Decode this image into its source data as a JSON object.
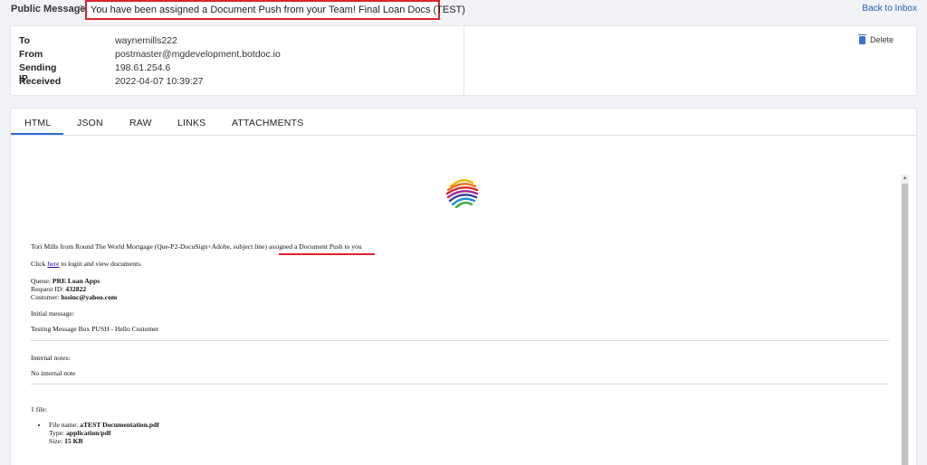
{
  "breadcrumb": {
    "root": "Public Message",
    "separator": ">",
    "subject": "You have been assigned a Document Push from your Team! Final Loan Docs (TEST)"
  },
  "back_link": "Back to Inbox",
  "details": {
    "to_label": "To",
    "to_value": "waynemills222",
    "from_label": "From",
    "from_value": "postmaster@mgdevelopment.botdoc.io",
    "ip_label": "Sending IP",
    "ip_value": "198.61.254.6",
    "received_label": "Received",
    "received_value": "2022-04-07 10:39:27"
  },
  "delete_label": "Delete",
  "tabs": [
    "HTML",
    "JSON",
    "RAW",
    "LINKS",
    "ATTACHMENTS"
  ],
  "active_tab": "HTML",
  "email": {
    "intro": "Tori Mills from Round The World Mortgage (Que-P2-DocuSign+Adobe, subject line) ",
    "intro_highlight": "assigned a Document Push to you",
    "click_prefix": "Click ",
    "click_link": "here",
    "click_suffix": " to login and view documents.",
    "queue_label": "Queue: ",
    "queue_value": "PRE Loan Apps",
    "request_label": "Request ID: ",
    "request_value": "432822",
    "customer_label": "Customer: ",
    "customer_value": "hssinc@yahoo.com",
    "initial_label": "Initial message:",
    "initial_value": "Testing Message Box PUSH - Hello Customer",
    "notes_label": "Internal notes:",
    "notes_value": "No internal note",
    "files_count": "1 file:",
    "file_name_label": "File name: ",
    "file_name_value": "aTEST Documentation.pdf",
    "file_type_label": "Type: ",
    "file_type_value": "application/pdf",
    "file_size_label": "Size: ",
    "file_size_value": "15 KB"
  },
  "colors": {
    "highlight": "#d9252c",
    "accent": "#2f6fd0",
    "link": "#1f5fb7"
  }
}
